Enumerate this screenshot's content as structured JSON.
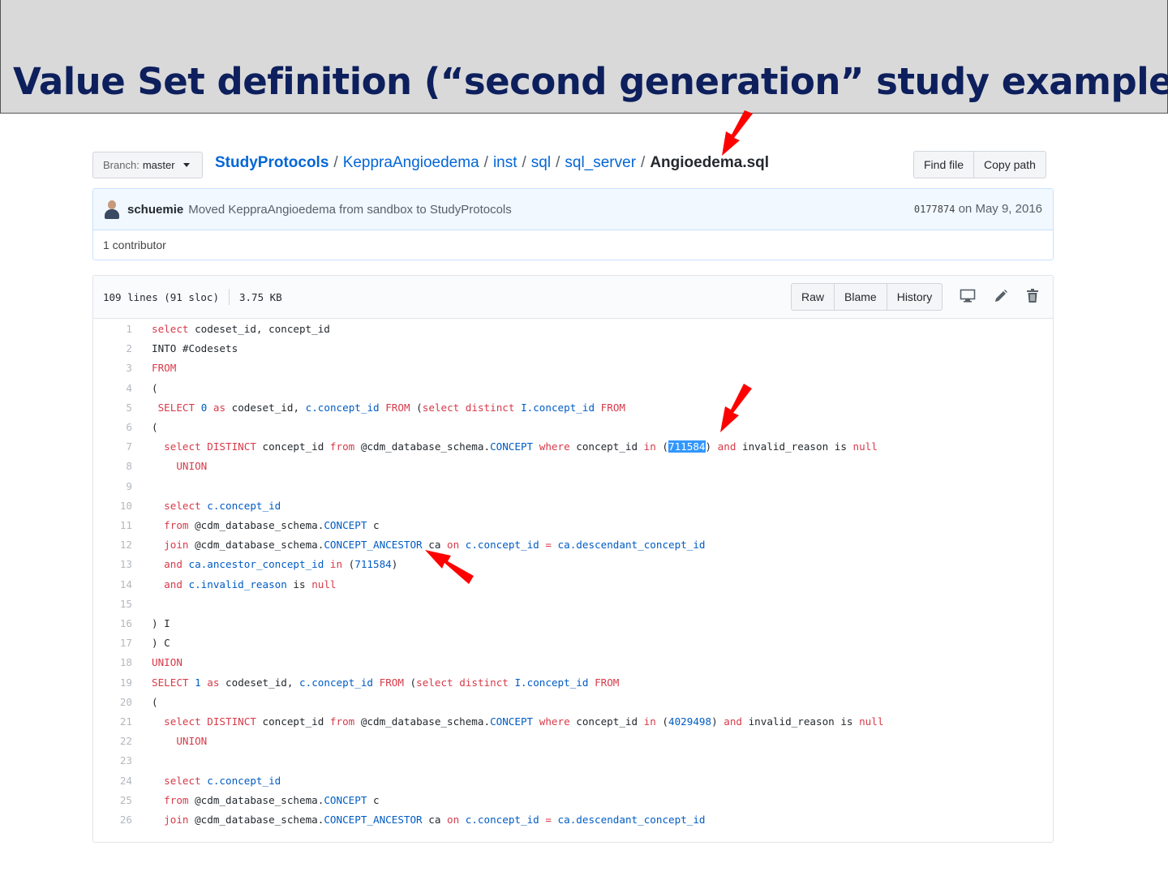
{
  "slide": {
    "title": "Value Set definition  (“second generation” study example)"
  },
  "repo": {
    "branch_label": "Branch:",
    "branch_name": "master",
    "breadcrumb": {
      "root": "StudyProtocols",
      "parts": [
        "KeppraAngioedema",
        "inst",
        "sql",
        "sql_server"
      ],
      "file": "Angioedema.sql"
    },
    "find_file": "Find file",
    "copy_path": "Copy path"
  },
  "commit": {
    "author": "schuemie",
    "message": "Moved KeppraAngioedema from sandbox to StudyProtocols",
    "sha": "0177874",
    "date": "on May 9, 2016",
    "contributors": "1 contributor"
  },
  "file": {
    "lines_info": "109 lines (91 sloc)",
    "size": "3.75 KB",
    "raw": "Raw",
    "blame": "Blame",
    "history": "History",
    "icons": [
      "desktop-icon",
      "pencil-icon",
      "trash-icon"
    ]
  },
  "code_lines": [
    {
      "n": "1",
      "t": [
        [
          "k",
          "select"
        ],
        [
          "p",
          " codeset_id, concept_id"
        ]
      ]
    },
    {
      "n": "2",
      "t": [
        [
          "p",
          "INTO #Codesets"
        ]
      ]
    },
    {
      "n": "3",
      "t": [
        [
          "k",
          "FROM"
        ]
      ]
    },
    {
      "n": "4",
      "t": [
        [
          "p",
          "("
        ]
      ]
    },
    {
      "n": "5",
      "t": [
        [
          "p",
          " "
        ],
        [
          "k",
          "SELECT"
        ],
        [
          "p",
          " "
        ],
        [
          "v",
          "0"
        ],
        [
          "p",
          " "
        ],
        [
          "k",
          "as"
        ],
        [
          "p",
          " codeset_id, "
        ],
        [
          "v",
          "c.concept_id"
        ],
        [
          "p",
          " "
        ],
        [
          "k",
          "FROM"
        ],
        [
          "p",
          " ("
        ],
        [
          "k",
          "select distinct"
        ],
        [
          "p",
          " "
        ],
        [
          "v",
          "I.concept_id"
        ],
        [
          "p",
          " "
        ],
        [
          "k",
          "FROM"
        ]
      ]
    },
    {
      "n": "6",
      "t": [
        [
          "p",
          "("
        ]
      ]
    },
    {
      "n": "7",
      "t": [
        [
          "p",
          "  "
        ],
        [
          "k",
          "select DISTINCT"
        ],
        [
          "p",
          " concept_id "
        ],
        [
          "k",
          "from"
        ],
        [
          "p",
          " @cdm_database_schema."
        ],
        [
          "v",
          "CONCEPT"
        ],
        [
          "p",
          " "
        ],
        [
          "k",
          "where"
        ],
        [
          "p",
          " concept_id "
        ],
        [
          "k",
          "in"
        ],
        [
          "p",
          " ("
        ],
        [
          "h",
          "711584"
        ],
        [
          "p",
          ") "
        ],
        [
          "k",
          "and"
        ],
        [
          "p",
          " invalid_reason "
        ],
        [
          "p",
          "is"
        ],
        [
          "p",
          " "
        ],
        [
          "k",
          "null"
        ]
      ]
    },
    {
      "n": "8",
      "t": [
        [
          "p",
          "    "
        ],
        [
          "k",
          "UNION"
        ]
      ]
    },
    {
      "n": "9",
      "t": [
        [
          "p",
          ""
        ]
      ]
    },
    {
      "n": "10",
      "t": [
        [
          "p",
          "  "
        ],
        [
          "k",
          "select"
        ],
        [
          "p",
          " "
        ],
        [
          "v",
          "c.concept_id"
        ]
      ]
    },
    {
      "n": "11",
      "t": [
        [
          "p",
          "  "
        ],
        [
          "k",
          "from"
        ],
        [
          "p",
          " @cdm_database_schema."
        ],
        [
          "v",
          "CONCEPT"
        ],
        [
          "p",
          " c"
        ]
      ]
    },
    {
      "n": "12",
      "t": [
        [
          "p",
          "  "
        ],
        [
          "k",
          "join"
        ],
        [
          "p",
          " @cdm_database_schema."
        ],
        [
          "v",
          "CONCEPT_ANCESTOR"
        ],
        [
          "p",
          " ca "
        ],
        [
          "k",
          "on"
        ],
        [
          "p",
          " "
        ],
        [
          "v",
          "c.concept_id"
        ],
        [
          "p",
          " "
        ],
        [
          "k",
          "="
        ],
        [
          "p",
          " "
        ],
        [
          "v",
          "ca.descendant_concept_id"
        ]
      ]
    },
    {
      "n": "13",
      "t": [
        [
          "p",
          "  "
        ],
        [
          "k",
          "and"
        ],
        [
          "p",
          " "
        ],
        [
          "v",
          "ca.ancestor_concept_id"
        ],
        [
          "p",
          " "
        ],
        [
          "k",
          "in"
        ],
        [
          "p",
          " ("
        ],
        [
          "v",
          "711584"
        ],
        [
          "p",
          ")"
        ]
      ]
    },
    {
      "n": "14",
      "t": [
        [
          "p",
          "  "
        ],
        [
          "k",
          "and"
        ],
        [
          "p",
          " "
        ],
        [
          "v",
          "c.invalid_reason"
        ],
        [
          "p",
          " is "
        ],
        [
          "k",
          "null"
        ]
      ]
    },
    {
      "n": "15",
      "t": [
        [
          "p",
          ""
        ]
      ]
    },
    {
      "n": "16",
      "t": [
        [
          "p",
          ") I"
        ]
      ]
    },
    {
      "n": "17",
      "t": [
        [
          "p",
          ") C"
        ]
      ]
    },
    {
      "n": "18",
      "t": [
        [
          "k",
          "UNION"
        ]
      ]
    },
    {
      "n": "19",
      "t": [
        [
          "k",
          "SELECT"
        ],
        [
          "p",
          " "
        ],
        [
          "v",
          "1"
        ],
        [
          "p",
          " "
        ],
        [
          "k",
          "as"
        ],
        [
          "p",
          " codeset_id, "
        ],
        [
          "v",
          "c.concept_id"
        ],
        [
          "p",
          " "
        ],
        [
          "k",
          "FROM"
        ],
        [
          "p",
          " ("
        ],
        [
          "k",
          "select distinct"
        ],
        [
          "p",
          " "
        ],
        [
          "v",
          "I.concept_id"
        ],
        [
          "p",
          " "
        ],
        [
          "k",
          "FROM"
        ]
      ]
    },
    {
      "n": "20",
      "t": [
        [
          "p",
          "("
        ]
      ]
    },
    {
      "n": "21",
      "t": [
        [
          "p",
          "  "
        ],
        [
          "k",
          "select DISTINCT"
        ],
        [
          "p",
          " concept_id "
        ],
        [
          "k",
          "from"
        ],
        [
          "p",
          " @cdm_database_schema."
        ],
        [
          "v",
          "CONCEPT"
        ],
        [
          "p",
          " "
        ],
        [
          "k",
          "where"
        ],
        [
          "p",
          " concept_id "
        ],
        [
          "k",
          "in"
        ],
        [
          "p",
          " ("
        ],
        [
          "v",
          "4029498"
        ],
        [
          "p",
          ") "
        ],
        [
          "k",
          "and"
        ],
        [
          "p",
          " invalid_reason "
        ],
        [
          "p",
          "is"
        ],
        [
          "p",
          " "
        ],
        [
          "k",
          "null"
        ]
      ]
    },
    {
      "n": "22",
      "t": [
        [
          "p",
          "    "
        ],
        [
          "k",
          "UNION"
        ]
      ]
    },
    {
      "n": "23",
      "t": [
        [
          "p",
          ""
        ]
      ]
    },
    {
      "n": "24",
      "t": [
        [
          "p",
          "  "
        ],
        [
          "k",
          "select"
        ],
        [
          "p",
          " "
        ],
        [
          "v",
          "c.concept_id"
        ]
      ]
    },
    {
      "n": "25",
      "t": [
        [
          "p",
          "  "
        ],
        [
          "k",
          "from"
        ],
        [
          "p",
          " @cdm_database_schema."
        ],
        [
          "v",
          "CONCEPT"
        ],
        [
          "p",
          " c"
        ]
      ]
    },
    {
      "n": "26",
      "t": [
        [
          "p",
          "  "
        ],
        [
          "k",
          "join"
        ],
        [
          "p",
          " @cdm_database_schema."
        ],
        [
          "v",
          "CONCEPT_ANCESTOR"
        ],
        [
          "p",
          " ca "
        ],
        [
          "k",
          "on"
        ],
        [
          "p",
          " "
        ],
        [
          "v",
          "c.concept_id"
        ],
        [
          "p",
          " "
        ],
        [
          "k",
          "="
        ],
        [
          "p",
          " "
        ],
        [
          "v",
          "ca.descendant_concept_id"
        ]
      ]
    }
  ],
  "colors": {
    "banner_bg": "#d9d9d9",
    "title": "#0d1f5c",
    "link": "#0366d6",
    "keyword": "#d73a49",
    "constant": "#005cc5",
    "highlight": "#3297fd",
    "arrow": "#ff0000"
  }
}
